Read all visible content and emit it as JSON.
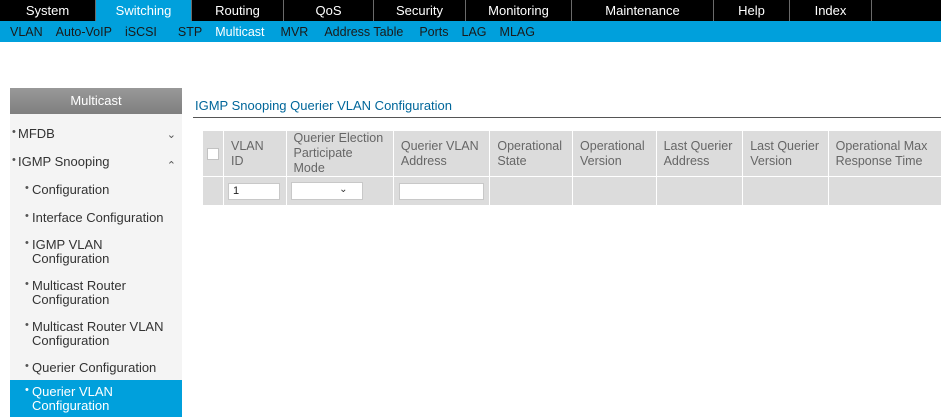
{
  "top_nav": {
    "tabs": [
      {
        "label": "System"
      },
      {
        "label": "Switching"
      },
      {
        "label": "Routing"
      },
      {
        "label": "QoS"
      },
      {
        "label": "Security"
      },
      {
        "label": "Monitoring"
      },
      {
        "label": "Maintenance"
      },
      {
        "label": "Help"
      },
      {
        "label": "Index"
      }
    ],
    "active": "Switching"
  },
  "sub_nav": {
    "items": [
      {
        "label": "VLAN"
      },
      {
        "label": "Auto-VoIP"
      },
      {
        "label": "iSCSI"
      },
      {
        "label": "STP"
      },
      {
        "label": "Multicast"
      },
      {
        "label": "MVR"
      },
      {
        "label": "Address Table"
      },
      {
        "label": "Ports"
      },
      {
        "label": "LAG"
      },
      {
        "label": "MLAG"
      }
    ],
    "active": "Multicast"
  },
  "sidebar": {
    "title": "Multicast",
    "items": [
      {
        "label": "MFDB",
        "lines": [],
        "expander": "chevron-down"
      },
      {
        "label": "IGMP Snooping",
        "lines": [],
        "expander": "chevron-up"
      },
      {
        "label": "Configuration",
        "lines": []
      },
      {
        "label": "Interface Configuration",
        "lines": []
      },
      {
        "label": "IGMP VLAN Configuration",
        "lines": [
          "IGMP VLAN",
          "Configuration"
        ]
      },
      {
        "label": "Multicast Router Configuration",
        "lines": [
          "Multicast Router",
          "Configuration"
        ]
      },
      {
        "label": "Multicast Router VLAN Configuration",
        "lines": [
          "Multicast Router VLAN",
          "Configuration"
        ]
      },
      {
        "label": "Querier Configuration",
        "lines": []
      },
      {
        "label": "Querier VLAN Configuration",
        "lines": [
          "Querier VLAN",
          "Configuration"
        ],
        "active": true
      }
    ]
  },
  "main": {
    "title": "IGMP Snooping Querier VLAN Configuration",
    "table": {
      "headers": [
        {
          "lines": [
            "VLAN ID"
          ]
        },
        {
          "lines": [
            "Querier Election",
            "Participate Mode"
          ]
        },
        {
          "lines": [
            "Querier VLAN",
            "Address"
          ]
        },
        {
          "lines": [
            "Operational",
            "State"
          ]
        },
        {
          "lines": [
            "Operational",
            "Version"
          ]
        },
        {
          "lines": [
            "Last Querier",
            "Address"
          ]
        },
        {
          "lines": [
            "Last Querier",
            "Version"
          ]
        },
        {
          "lines": [
            "Operational Max",
            "Response Time"
          ]
        }
      ],
      "input_row": {
        "vlan_id": "1",
        "participate_mode": "",
        "querier_vlan_address": ""
      }
    }
  },
  "colors": {
    "accent": "#00a0dc",
    "nav_bg": "#000000",
    "sidebar_header": "#8c8c8c",
    "sidebar_bg": "#f4f4f4",
    "title_text": "#00669a",
    "table_bg": "#dcdcdc"
  },
  "icons": [
    "chevron-down-icon",
    "chevron-up-icon",
    "bullet-icon",
    "checkbox-icon",
    "dropdown-chevron-icon"
  ]
}
